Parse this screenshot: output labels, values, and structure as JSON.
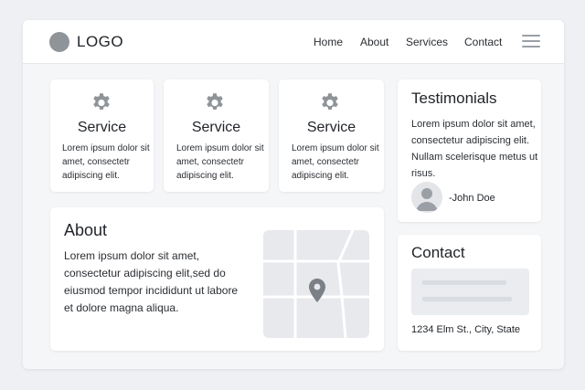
{
  "header": {
    "logo_text": "LOGO",
    "nav": [
      "Home",
      "About",
      "Services",
      "Contact"
    ]
  },
  "services": [
    {
      "title": "Service",
      "description": "Lorem ipsum dolor sit amet, consectetr adipiscing elit."
    },
    {
      "title": "Service",
      "description": "Lorem ipsum dolor sit amet, consectetr adipiscing elit."
    },
    {
      "title": "Service",
      "description": "Lorem ipsum dolor sit amet, consectetr adipiscing elit."
    }
  ],
  "about": {
    "title": "About",
    "text": "Lorem ipsum dolor sit amet, consectetur adipiscing elit,sed do eiusmod tempor incididunt ut labore et dolore magna aliqua."
  },
  "testimonials": {
    "title": "Testimonials",
    "quote": "Lorem ipsum dolor sit amet, consectetur adipiscing elit. Nullam scelerisque metus ut risus.",
    "author": "-John Doe"
  },
  "contact": {
    "title": "Contact",
    "address": "1234 Elm St., City, State"
  },
  "colors": {
    "page_background": "#eef0f3",
    "card_background": "#ffffff",
    "icon_gray": "#8f9499",
    "map_background": "#e7e9ec"
  },
  "icons": {
    "logo": "circle-logo-icon",
    "menu": "hamburger-menu-icon",
    "service": "gear-icon",
    "map_pin": "map-pin-icon",
    "avatar": "user-avatar-icon"
  }
}
